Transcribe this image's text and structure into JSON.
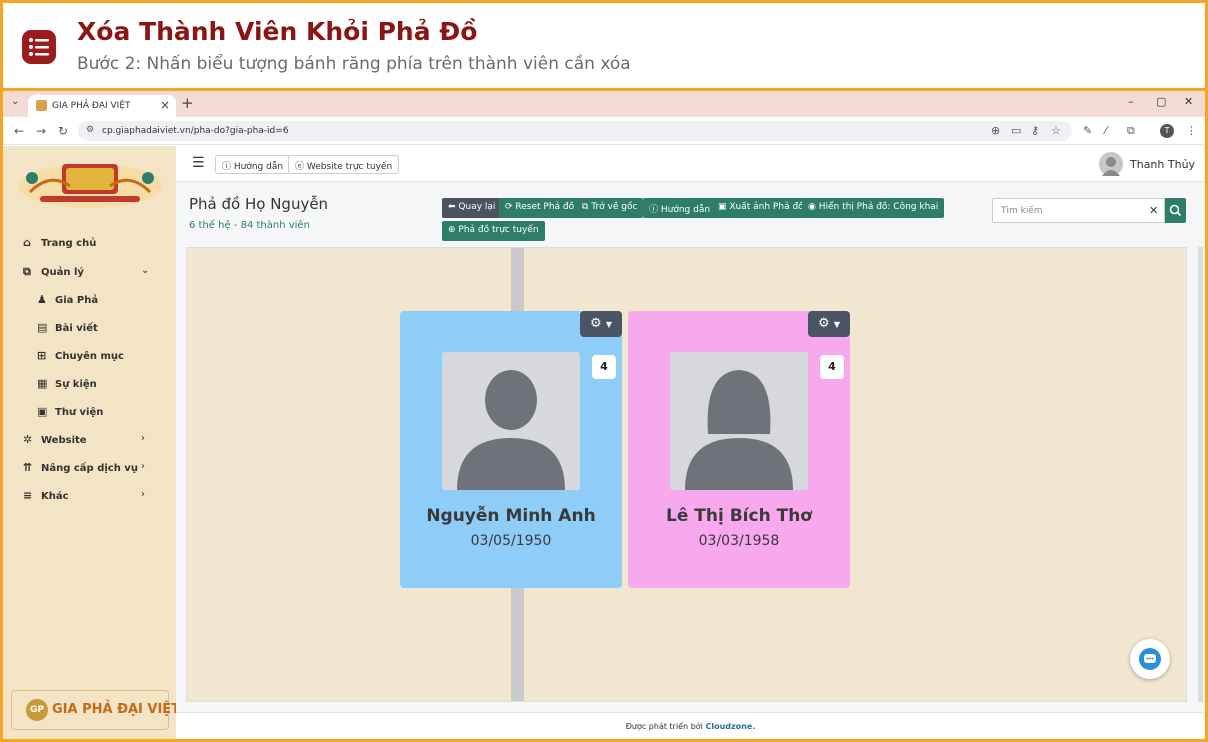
{
  "banner": {
    "title": "Xóa Thành Viên Khỏi Phả Đồ",
    "subtitle": "Bước 2: Nhấn biểu tượng bánh răng phía trên thành viên cần xóa",
    "icon": "list-icon",
    "accent": "#9b1c1c"
  },
  "browser": {
    "tab_title": "GIA PHẢ ĐẠI VIỆT",
    "url": "cp.giaphadaiviet.vn/pha-do?gia-pha-id=6",
    "profile_initial": "T"
  },
  "sidebar": {
    "items": [
      {
        "label": "Trang chủ",
        "icon": "home-icon",
        "glyph": "⌂"
      },
      {
        "label": "Quản lý",
        "icon": "sitemap-icon",
        "glyph": "⧉",
        "chevron": "⌄"
      },
      {
        "label": "Gia Phả",
        "icon": "users-icon",
        "glyph": "♟"
      },
      {
        "label": "Bài viết",
        "icon": "newspaper-icon",
        "glyph": "▤"
      },
      {
        "label": "Chuyên mục",
        "icon": "grid-icon",
        "glyph": "⊞"
      },
      {
        "label": "Sự kiện",
        "icon": "calendar-icon",
        "glyph": "▦"
      },
      {
        "label": "Thư viện",
        "icon": "images-icon",
        "glyph": "▣"
      },
      {
        "label": "Website",
        "icon": "gear-icon",
        "glyph": "✲",
        "chevron": "›"
      },
      {
        "label": "Nâng cấp dịch vụ",
        "icon": "upgrade-icon",
        "glyph": "⇈",
        "chevron": "›"
      },
      {
        "label": "Khác",
        "icon": "bars-icon",
        "glyph": "≡",
        "chevron": "›"
      }
    ],
    "footer_logo_text": "GIA PHẢ ĐẠI VIỆT",
    "footer_logo_mark": "GP"
  },
  "topbar": {
    "guide_label": "Hướng dẫn",
    "website_label": "Website trực tuyến",
    "user_name": "Thanh Thủy"
  },
  "page": {
    "title": "Phả đồ Họ Nguyễn",
    "subtitle": "6 thế hệ - 84 thành viên"
  },
  "actions": {
    "back": "Quay lại",
    "reset": "Reset Phả đồ",
    "root": "Trở về gốc",
    "guide": "Hướng dẫn",
    "export": "Xuất ảnh Phả đồ",
    "visibility": "Hiển thị Phả đồ: Công khai",
    "online": "Phả đồ trực tuyến"
  },
  "search": {
    "placeholder": "Tìm kiếm",
    "clear": "✕"
  },
  "members": [
    {
      "name": "Nguyễn Minh Anh",
      "date": "03/05/1950",
      "count": "4",
      "color": "#8ecdf7",
      "gender": "male"
    },
    {
      "name": "Lê Thị Bích Thơ",
      "date": "03/03/1958",
      "count": "4",
      "color": "#f8a9ee",
      "gender": "female"
    }
  ],
  "footer": {
    "prefix": "Được phát triển bởi",
    "company": "Cloudzone."
  }
}
